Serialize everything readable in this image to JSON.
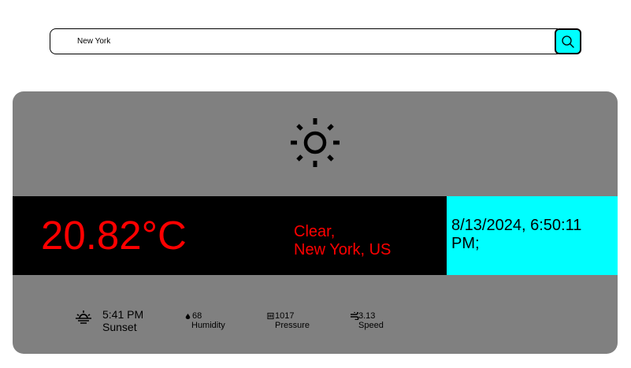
{
  "search": {
    "value": "New York",
    "button_icon": "search-icon"
  },
  "weather": {
    "icon": "sun-icon",
    "temperature": "20.82°C",
    "condition": "Clear,",
    "location": "New York, US",
    "datetime": "8/13/2024, 6:50:11 PM;"
  },
  "details": {
    "sunset_time": "5:41 PM",
    "sunset_label": "Sunset",
    "humidity_value": "68",
    "humidity_label": "Humidity",
    "pressure_value": "1017",
    "pressure_label": "Pressure",
    "speed_value": "3.13",
    "speed_label": "Speed"
  },
  "colors": {
    "card_bg": "#808080",
    "accent_cyan": "#00ffff",
    "temp_red": "#ff0000",
    "band_black": "#000000"
  }
}
